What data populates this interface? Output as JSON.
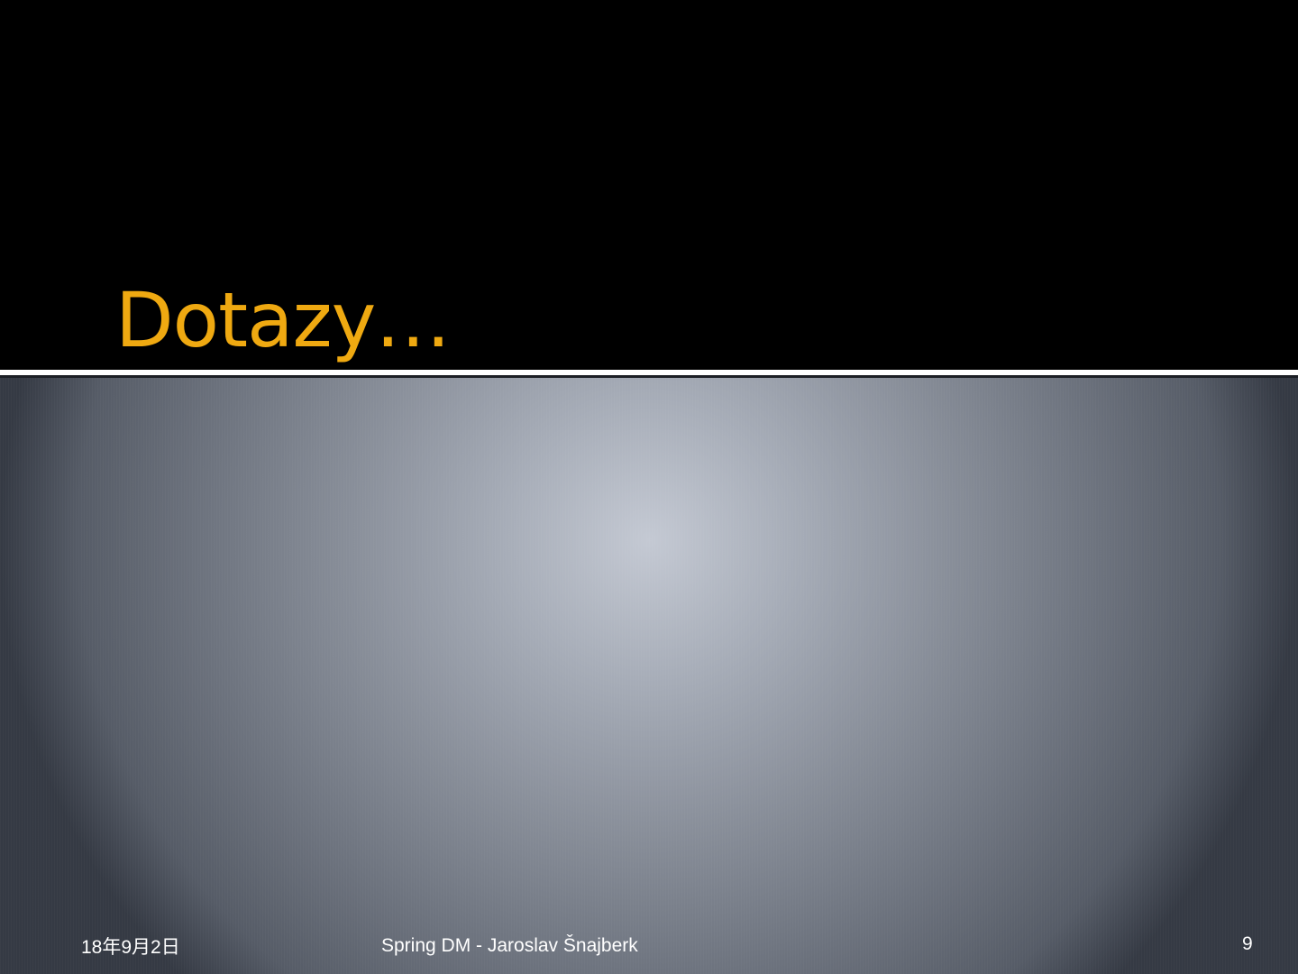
{
  "slide": {
    "title": "Dotazy…",
    "footer": {
      "date": "18年9月2日",
      "text": "Spring DM - Jaroslav Šnajberk",
      "page_number": "9"
    }
  },
  "colors": {
    "title": "#EFA911",
    "background_top": "#000000",
    "divider": "#FFFFFF",
    "content_center": "#C4C9D3",
    "content_edge": "#353A44",
    "footer_text": "#FFFFFF"
  }
}
